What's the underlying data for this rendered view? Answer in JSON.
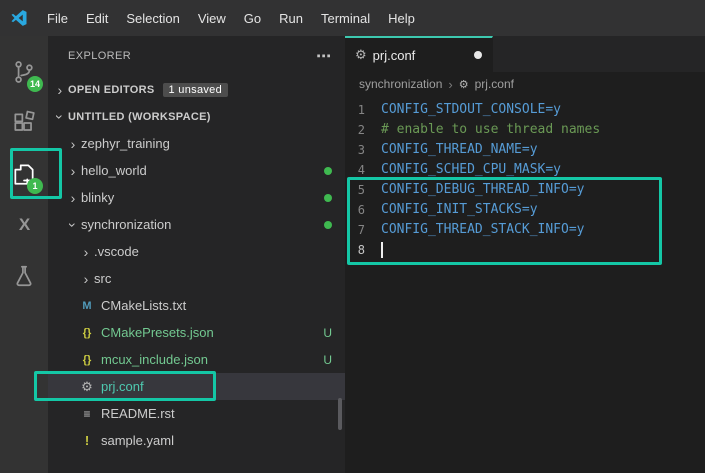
{
  "menu": {
    "items": [
      "File",
      "Edit",
      "Selection",
      "View",
      "Go",
      "Run",
      "Terminal",
      "Help"
    ]
  },
  "activity_bar": {
    "items": [
      {
        "icon": "source-control-icon",
        "badge": "14",
        "active": false
      },
      {
        "icon": "extensions-icon",
        "badge": "",
        "active": false
      },
      {
        "icon": "files-icon",
        "badge": "1",
        "active": true,
        "annotated": true
      },
      {
        "icon": "x-extension-icon",
        "badge": "",
        "active": false
      },
      {
        "icon": "flask-icon",
        "badge": "",
        "active": false
      }
    ]
  },
  "sidebar": {
    "title": "EXPLORER",
    "open_editors_label": "OPEN EDITORS",
    "unsaved_badge": "1 unsaved",
    "workspace_label": "UNTITLED (WORKSPACE)",
    "tree": [
      {
        "label": "zephyr_training",
        "type": "folder",
        "state": "collapsed",
        "indent": 1
      },
      {
        "label": "hello_world",
        "type": "folder",
        "state": "collapsed",
        "indent": 1,
        "dot": true
      },
      {
        "label": "blinky",
        "type": "folder",
        "state": "collapsed",
        "indent": 1,
        "dot": true
      },
      {
        "label": "synchronization",
        "type": "folder",
        "state": "expanded",
        "indent": 1,
        "dot": true
      },
      {
        "label": ".vscode",
        "type": "folder",
        "state": "collapsed",
        "indent": 2
      },
      {
        "label": "src",
        "type": "folder",
        "state": "collapsed",
        "indent": 2
      },
      {
        "label": "CMakeLists.txt",
        "type": "file",
        "icon": "cmake-icon",
        "indent": 2
      },
      {
        "label": "CMakePresets.json",
        "type": "file",
        "icon": "json-icon",
        "indent": 2,
        "git": "U",
        "color": "untracked"
      },
      {
        "label": "mcux_include.json",
        "type": "file",
        "icon": "json-icon",
        "indent": 2,
        "git": "U",
        "color": "untracked"
      },
      {
        "label": "prj.conf",
        "type": "file",
        "icon": "gear-icon",
        "indent": 2,
        "selected": true,
        "annotated": true
      },
      {
        "label": "README.rst",
        "type": "file",
        "icon": "file-icon",
        "indent": 2
      },
      {
        "label": "sample.yaml",
        "type": "file",
        "icon": "yaml-icon",
        "indent": 2
      }
    ]
  },
  "editor": {
    "tab": {
      "label": "prj.conf",
      "icon": "gear-icon",
      "modified": true
    },
    "breadcrumb": {
      "parent": "synchronization",
      "file": "prj.conf"
    },
    "code": {
      "lines": [
        {
          "num": "1",
          "text": "CONFIG_STDOUT_CONSOLE=y",
          "kind": "config"
        },
        {
          "num": "2",
          "text": "# enable to use thread names",
          "kind": "comment"
        },
        {
          "num": "3",
          "text": "CONFIG_THREAD_NAME=y",
          "kind": "config"
        },
        {
          "num": "4",
          "text": "CONFIG_SCHED_CPU_MASK=y",
          "kind": "config"
        },
        {
          "num": "5",
          "text": "CONFIG_DEBUG_THREAD_INFO=y",
          "kind": "config"
        },
        {
          "num": "6",
          "text": "CONFIG_INIT_STACKS=y",
          "kind": "config"
        },
        {
          "num": "7",
          "text": "CONFIG_THREAD_STACK_INFO=y",
          "kind": "config"
        },
        {
          "num": "8",
          "text": "",
          "kind": "cursor"
        }
      ]
    }
  },
  "colors": {
    "annotation": "#14c7a6",
    "accent_tab": "#3dc9b0",
    "config_text": "#569cd6",
    "comment_text": "#6a9955",
    "untracked": "#73c991",
    "badge_green": "#3fb950",
    "selected_file": "#4ec9b0"
  }
}
